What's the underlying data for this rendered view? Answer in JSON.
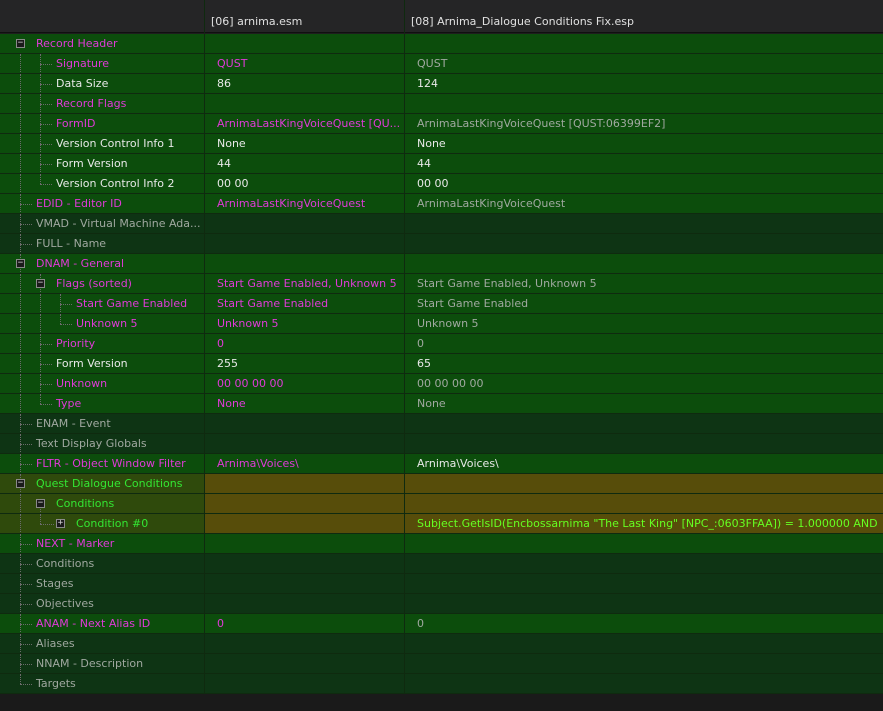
{
  "header": {
    "col0": "",
    "col1": "[06] arnima.esm",
    "col2": "[08] Arnima_Dialogue Conditions Fix.esp"
  },
  "rows": [
    {
      "label": "Record Header",
      "v1": "",
      "v2": ""
    },
    {
      "label": "Signature",
      "v1": "QUST",
      "v2": "QUST"
    },
    {
      "label": "Data Size",
      "v1": "86",
      "v2": "124"
    },
    {
      "label": "Record Flags",
      "v1": "",
      "v2": ""
    },
    {
      "label": "FormID",
      "v1": "ArnimaLastKingVoiceQuest [QU...",
      "v2": "ArnimaLastKingVoiceQuest [QUST:06399EF2]"
    },
    {
      "label": "Version Control Info 1",
      "v1": "None",
      "v2": "None"
    },
    {
      "label": "Form Version",
      "v1": "44",
      "v2": "44"
    },
    {
      "label": "Version Control Info 2",
      "v1": "00 00",
      "v2": "00 00"
    },
    {
      "label": "EDID - Editor ID",
      "v1": "ArnimaLastKingVoiceQuest",
      "v2": "ArnimaLastKingVoiceQuest"
    },
    {
      "label": "VMAD - Virtual Machine Ada...",
      "v1": "",
      "v2": ""
    },
    {
      "label": "FULL - Name",
      "v1": "",
      "v2": ""
    },
    {
      "label": "DNAM - General",
      "v1": "",
      "v2": ""
    },
    {
      "label": "Flags (sorted)",
      "v1": "Start Game Enabled, Unknown 5",
      "v2": "Start Game Enabled, Unknown 5"
    },
    {
      "label": "Start Game Enabled",
      "v1": "Start Game Enabled",
      "v2": "Start Game Enabled"
    },
    {
      "label": "Unknown 5",
      "v1": "Unknown 5",
      "v2": "Unknown 5"
    },
    {
      "label": "Priority",
      "v1": "0",
      "v2": "0"
    },
    {
      "label": "Form Version",
      "v1": "255",
      "v2": "65"
    },
    {
      "label": "Unknown",
      "v1": "00 00 00 00",
      "v2": "00 00 00 00"
    },
    {
      "label": "Type",
      "v1": "None",
      "v2": "None"
    },
    {
      "label": "ENAM - Event",
      "v1": "",
      "v2": ""
    },
    {
      "label": "Text Display Globals",
      "v1": "",
      "v2": ""
    },
    {
      "label": "FLTR - Object Window Filter",
      "v1": "Arnima\\Voices\\",
      "v2": "Arnima\\Voices\\"
    },
    {
      "label": "Quest Dialogue Conditions",
      "v1": "",
      "v2": ""
    },
    {
      "label": "Conditions",
      "v1": "",
      "v2": ""
    },
    {
      "label": "Condition #0",
      "v1": "",
      "v2": "Subject.GetIsID(Encbossarnima \"The Last King\" [NPC_:0603FFAA]) = 1.000000 AND"
    },
    {
      "label": "NEXT - Marker",
      "v1": "",
      "v2": ""
    },
    {
      "label": "Conditions",
      "v1": "",
      "v2": ""
    },
    {
      "label": "Stages",
      "v1": "",
      "v2": ""
    },
    {
      "label": "Objectives",
      "v1": "",
      "v2": ""
    },
    {
      "label": "ANAM - Next Alias ID",
      "v1": "0",
      "v2": "0"
    },
    {
      "label": "Aliases",
      "v1": "",
      "v2": ""
    },
    {
      "label": "NNAM - Description",
      "v1": "",
      "v2": ""
    },
    {
      "label": "Targets",
      "v1": "",
      "v2": ""
    }
  ],
  "colors": {
    "green_row": "#0c4d0c",
    "dark_row": "#0e3414",
    "conflict_row": "#574d0a",
    "pink_text": "#e03ad8",
    "lime_text": "#33e633"
  }
}
